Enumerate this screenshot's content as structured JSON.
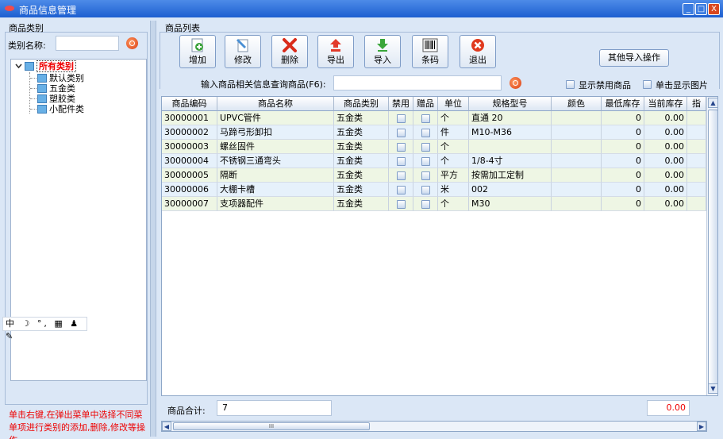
{
  "window": {
    "title": "商品信息管理",
    "buttons": {
      "minimize": "_",
      "maximize": "□",
      "close": "X"
    }
  },
  "left": {
    "group_caption": "商品类别",
    "category_name_label": "类别名称:",
    "category_name_value": "",
    "tree": {
      "root": "所有类别",
      "children": [
        "默认类别",
        "五金类",
        "塑胶类",
        "小配件类"
      ]
    },
    "ime_bar": "中 ☽ °, ▦ ♟ ✎",
    "hint": "单击右键,在弹出菜单中选择不同菜单项进行类别的添加,删除,修改等操作"
  },
  "right": {
    "group_caption": "商品列表",
    "toolbar": {
      "add": "增加",
      "edit": "修改",
      "delete": "删除",
      "export": "导出",
      "import": "导入",
      "barcode": "条码",
      "exit": "退出",
      "other_import": "其他导入操作"
    },
    "query_label": "输入商品相关信息查询商品(F6):",
    "query_value": "",
    "show_disabled_label": "显示禁用商品",
    "click_show_image_label": "单击显示图片",
    "grid": {
      "columns": [
        "商品编码",
        "商品名称",
        "商品类别",
        "禁用",
        "赠品",
        "单位",
        "规格型号",
        "颜色",
        "最低库存",
        "当前库存",
        "指"
      ],
      "rows": [
        {
          "code": "30000001",
          "name": "UPVC管件",
          "category": "五金类",
          "unit": "个",
          "spec": "直通 20",
          "color": "",
          "min_stock": "0",
          "cur_stock": "0.00"
        },
        {
          "code": "30000002",
          "name": "马蹄弓形卸扣",
          "category": "五金类",
          "unit": "件",
          "spec": "M10-M36",
          "color": "",
          "min_stock": "0",
          "cur_stock": "0.00"
        },
        {
          "code": "30000003",
          "name": "螺丝固件",
          "category": "五金类",
          "unit": "个",
          "spec": "",
          "color": "",
          "min_stock": "0",
          "cur_stock": "0.00"
        },
        {
          "code": "30000004",
          "name": "不锈钢三通弯头",
          "category": "五金类",
          "unit": "个",
          "spec": "1/8-4寸",
          "color": "",
          "min_stock": "0",
          "cur_stock": "0.00"
        },
        {
          "code": "30000005",
          "name": "隔断",
          "category": "五金类",
          "unit": "平方",
          "spec": "按需加工定制",
          "color": "",
          "min_stock": "0",
          "cur_stock": "0.00"
        },
        {
          "code": "30000006",
          "name": "大棚卡槽",
          "category": "五金类",
          "unit": "米",
          "spec": "002",
          "color": "",
          "min_stock": "0",
          "cur_stock": "0.00"
        },
        {
          "code": "30000007",
          "name": "支项器配件",
          "category": "五金类",
          "unit": "个",
          "spec": "M30",
          "color": "",
          "min_stock": "0",
          "cur_stock": "0.00"
        }
      ]
    },
    "footer": {
      "total_label": "商品合计:",
      "total_count": "7",
      "total_amount": "0.00"
    },
    "hscroll_grip": "III"
  },
  "colors": {
    "title_bar": "#1d5fd0",
    "row_alt_green": "#eef6e4",
    "row_alt_blue": "#e6f1fb",
    "hint_red": "#ee0000"
  }
}
